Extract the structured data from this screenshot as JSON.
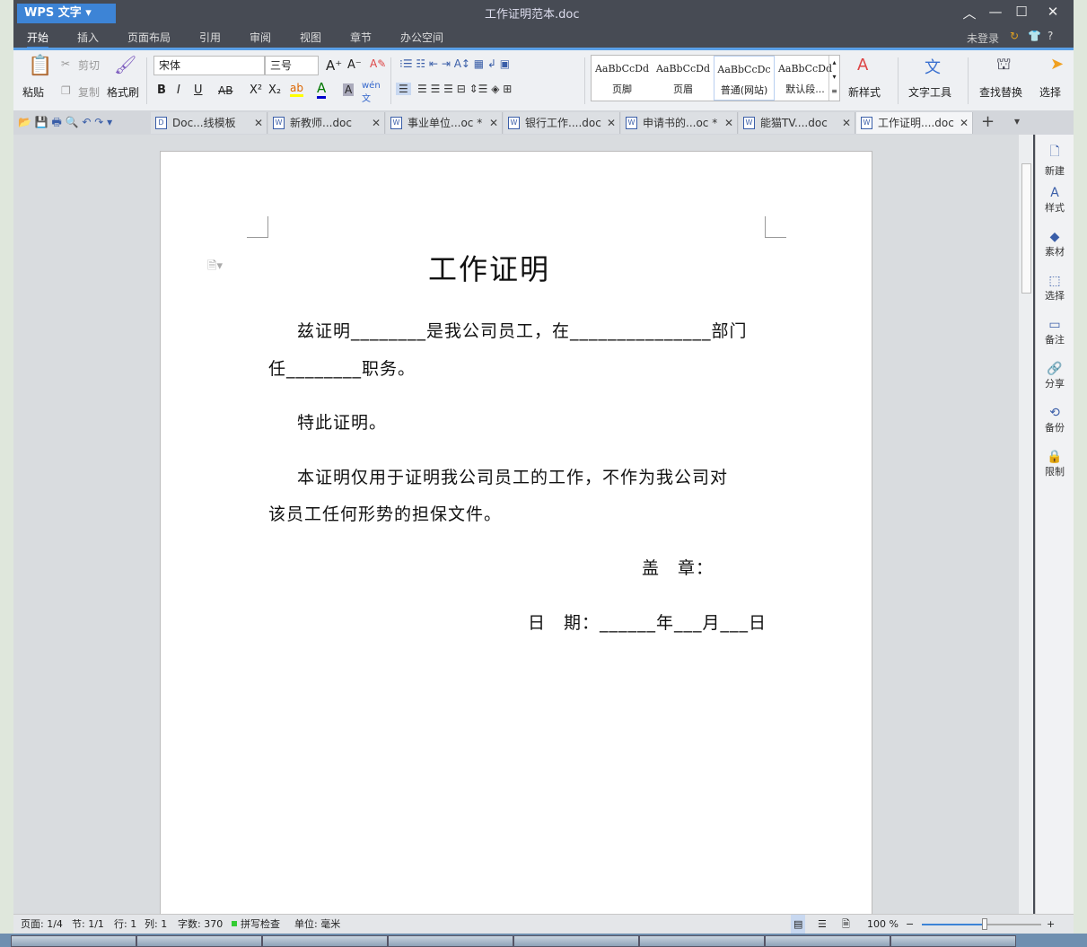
{
  "app": {
    "name": "WPS 文字",
    "doc_title": "工作证明范本.doc"
  },
  "menu": {
    "tabs": [
      "开始",
      "插入",
      "页面布局",
      "引用",
      "审阅",
      "视图",
      "章节",
      "办公空间"
    ],
    "login": "未登录",
    "help": "?"
  },
  "ribbon": {
    "paste": "粘贴",
    "cut": "剪切",
    "copy": "复制",
    "format_painter": "格式刷",
    "font": "宋体",
    "size": "三号",
    "bold": "B",
    "italic": "I",
    "underline": "U",
    "strike": "AB",
    "superscript": "X²",
    "subscript": "X₂",
    "styles": [
      {
        "preview": "AaBbCcDd",
        "name": "页脚"
      },
      {
        "preview": "AaBbCcDd",
        "name": "页眉"
      },
      {
        "preview": "AaBbCcDc",
        "name": "普通(网站)"
      },
      {
        "preview": "AaBbCcDd",
        "name": "默认段..."
      }
    ],
    "new_style": "新样式",
    "text_tools": "文字工具",
    "find_replace": "查找替换",
    "select": "选择"
  },
  "tabs": [
    {
      "label": "Doc...线模板"
    },
    {
      "label": "新教师...doc"
    },
    {
      "label": "事业单位...oc *"
    },
    {
      "label": "银行工作....doc"
    },
    {
      "label": "申请书的...oc *"
    },
    {
      "label": "能猫TV....doc"
    },
    {
      "label": "工作证明....doc",
      "active": true
    }
  ],
  "document": {
    "title": "工作证明",
    "p1a": "兹证明________是我公司员工，在_______________部门",
    "p1b": "任________职务。",
    "p2": "特此证明。",
    "p3a": "本证明仅用于证明我公司员工的工作，不作为我公司对",
    "p3b": "该员工任何形势的担保文件。",
    "seal": "盖　章：",
    "date": "日　期：______年___月___日"
  },
  "sidebar": [
    "新建",
    "样式",
    "素材",
    "选择",
    "备注",
    "分享",
    "备份",
    "限制"
  ],
  "status": {
    "page": "页面: 1/4",
    "section": "节: 1/1",
    "row": "行: 1",
    "col": "列: 1",
    "words": "字数: 370",
    "spell": "拼写检查",
    "unit": "单位: 毫米",
    "zoom": "100 %",
    "zoom_value": 100
  }
}
